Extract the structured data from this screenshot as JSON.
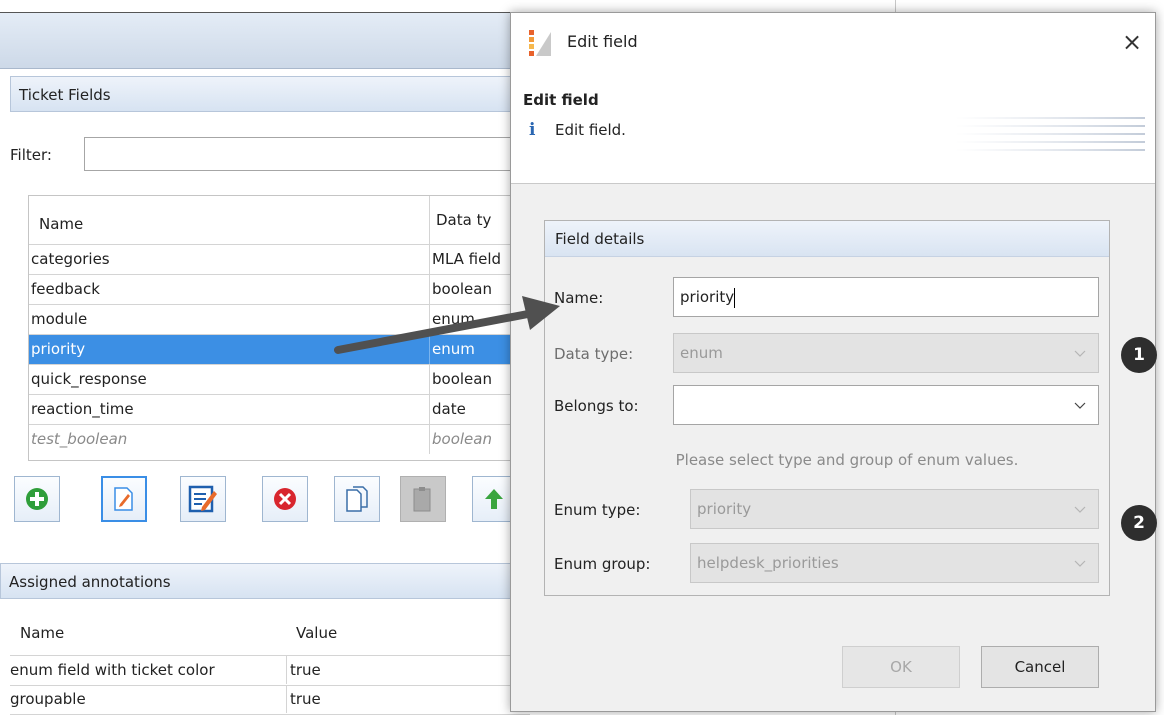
{
  "background": {
    "ticket_fields_panel": {
      "title": "Ticket Fields"
    },
    "filter": {
      "label": "Filter:",
      "value": ""
    },
    "fields_table": {
      "columns": [
        "Name",
        "Data ty"
      ],
      "rows": [
        {
          "name": "categories",
          "type": "MLA field"
        },
        {
          "name": "feedback",
          "type": "boolean"
        },
        {
          "name": "module",
          "type": "enum"
        },
        {
          "name": "priority",
          "type": "enum"
        },
        {
          "name": "quick_response",
          "type": "boolean"
        },
        {
          "name": "reaction_time",
          "type": "date"
        },
        {
          "name": "test_boolean",
          "type": "boolean"
        }
      ]
    },
    "toolbar_buttons": [
      "add-icon",
      "edit-icon",
      "edit-form-icon",
      "delete-icon",
      "copy-icon",
      "paste-icon",
      "move-up-icon"
    ],
    "annotations_panel": {
      "title": "Assigned annotations"
    },
    "annotations_table": {
      "columns": [
        "Name",
        "Value"
      ],
      "rows": [
        {
          "name": "enum field with ticket color",
          "value": "true"
        },
        {
          "name": "groupable",
          "value": "true"
        }
      ]
    }
  },
  "dialog": {
    "title": "Edit field",
    "close_glyph": "×",
    "banner": {
      "heading": "Edit field",
      "info_glyph": "i",
      "message": "Edit field."
    },
    "group": {
      "title": "Field details",
      "name_label": "Name:",
      "name_value": "priority",
      "data_type_label": "Data type:",
      "data_type_value": "enum",
      "belongs_to_label": "Belongs to:",
      "belongs_to_value": "",
      "hint": "Please select type and group of enum values.",
      "enum_type_label": "Enum type:",
      "enum_type_value": "priority",
      "enum_group_label": "Enum group:",
      "enum_group_value": "helpdesk_priorities"
    },
    "ok_label": "OK",
    "cancel_label": "Cancel"
  },
  "callouts": [
    "1",
    "2"
  ],
  "colors": {
    "selection": "#3c8fe4",
    "panel_header": "#d7e3f2",
    "callout": "#2e2e2e",
    "arrow": "#505050"
  }
}
